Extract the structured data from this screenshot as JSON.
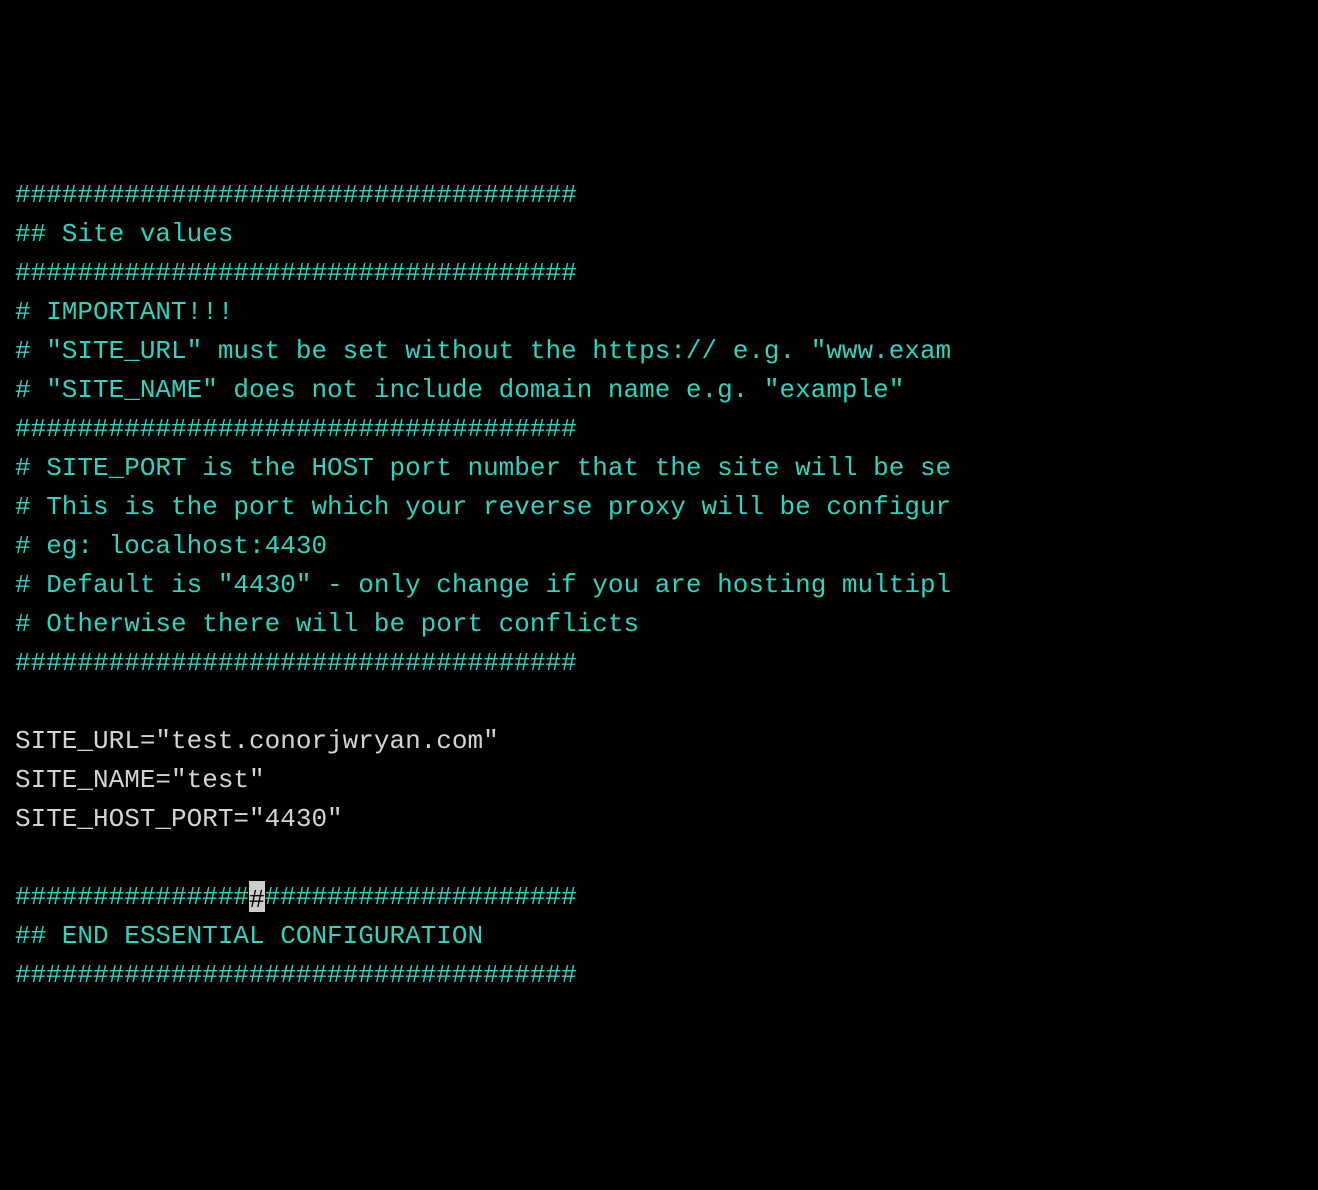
{
  "lines": [
    {
      "type": "comment",
      "text": "####################################"
    },
    {
      "type": "comment",
      "text": "## Site values"
    },
    {
      "type": "comment",
      "text": "####################################"
    },
    {
      "type": "comment",
      "text": "# IMPORTANT!!!"
    },
    {
      "type": "comment",
      "text": "# \"SITE_URL\" must be set without the https:// e.g. \"www.exam"
    },
    {
      "type": "comment",
      "text": "# \"SITE_NAME\" does not include domain name e.g. \"example\""
    },
    {
      "type": "comment",
      "text": "####################################"
    },
    {
      "type": "comment",
      "text": "# SITE_PORT is the HOST port number that the site will be se"
    },
    {
      "type": "comment",
      "text": "# This is the port which your reverse proxy will be configur"
    },
    {
      "type": "comment",
      "text": "# eg: localhost:4430"
    },
    {
      "type": "comment",
      "text": "# Default is \"4430\" - only change if you are hosting multipl"
    },
    {
      "type": "comment",
      "text": "# Otherwise there will be port conflicts"
    },
    {
      "type": "comment",
      "text": "####################################"
    },
    {
      "type": "blank",
      "text": ""
    },
    {
      "type": "code",
      "text": "SITE_URL=\"test.conorjwryan.com\""
    },
    {
      "type": "code",
      "text": "SITE_NAME=\"test\""
    },
    {
      "type": "code",
      "text": "SITE_HOST_PORT=\"4430\""
    },
    {
      "type": "blank",
      "text": ""
    },
    {
      "type": "cursor-line",
      "before": "###############",
      "after": "####################"
    },
    {
      "type": "comment",
      "text": "## END ESSENTIAL CONFIGURATION"
    },
    {
      "type": "comment",
      "text": "####################################"
    }
  ]
}
